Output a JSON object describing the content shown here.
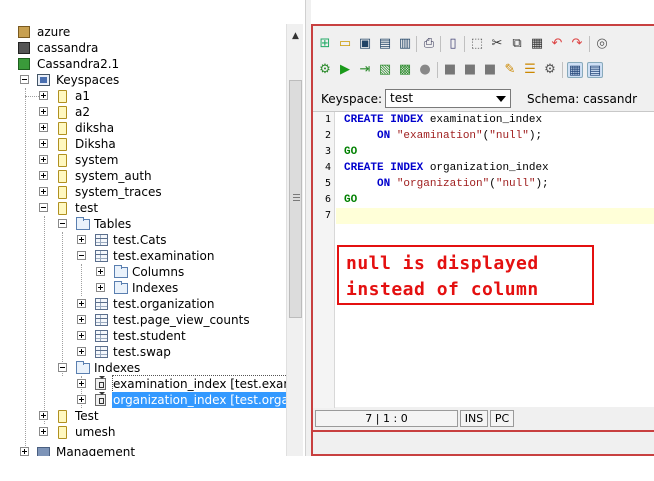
{
  "tree": {
    "top_items": [
      {
        "label": "azure"
      },
      {
        "label": "cassandra"
      },
      {
        "label": "Cassandra2.1"
      }
    ],
    "keyspaces_label": "Keyspaces",
    "keyspaces": [
      "a1",
      "a2",
      "diksha",
      "Diksha",
      "system",
      "system_auth",
      "system_traces",
      "test"
    ],
    "test_children": {
      "tables_label": "Tables",
      "tables": [
        "test.Cats",
        "test.examination",
        "test.organization",
        "test.page_view_counts",
        "test.student",
        "test.swap"
      ],
      "examination_children": [
        "Columns",
        "Indexes"
      ],
      "indexes_label": "Indexes",
      "indexes": [
        "examination_index [test.exam",
        "organization_index [test.orga"
      ]
    },
    "after_test": [
      "Test",
      "umesh"
    ],
    "management_label": "Management"
  },
  "keyspace_bar": {
    "label": "Keyspace:",
    "selected": "test",
    "schema_label": "Schema: cassandr"
  },
  "editor": {
    "line_numbers": [
      "1",
      "2",
      "3",
      "4",
      "5",
      "6",
      "7"
    ],
    "lines": [
      [
        {
          "t": "CREATE ",
          "c": "kw"
        },
        {
          "t": "INDEX ",
          "c": "kw"
        },
        {
          "t": "examination_index",
          "c": "plain"
        }
      ],
      [
        {
          "t": "     ON ",
          "c": "kw"
        },
        {
          "t": "\"examination\"",
          "c": "str"
        },
        {
          "t": "(",
          "c": "plain"
        },
        {
          "t": "\"null\"",
          "c": "str"
        },
        {
          "t": ");",
          "c": "plain"
        }
      ],
      [
        {
          "t": "GO",
          "c": "go"
        }
      ],
      [
        {
          "t": "CREATE ",
          "c": "kw"
        },
        {
          "t": "INDEX ",
          "c": "kw"
        },
        {
          "t": "organization_index",
          "c": "plain"
        }
      ],
      [
        {
          "t": "     ON ",
          "c": "kw"
        },
        {
          "t": "\"organization\"",
          "c": "str"
        },
        {
          "t": "(",
          "c": "plain"
        },
        {
          "t": "\"null\"",
          "c": "str"
        },
        {
          "t": ");",
          "c": "plain"
        }
      ],
      [
        {
          "t": "GO",
          "c": "go"
        }
      ],
      []
    ]
  },
  "annotation": {
    "line1": "null is displayed",
    "line2": "instead of column",
    "color": "#e41010"
  },
  "status_bar": {
    "position": "7 | 1 : 0",
    "mode": "INS",
    "line_ending": "PC"
  },
  "colors": {
    "selection": "#3399ff",
    "keyword": "#0000cc",
    "string": "#a02020",
    "go": "#008000",
    "editor_border": "#c84040"
  }
}
